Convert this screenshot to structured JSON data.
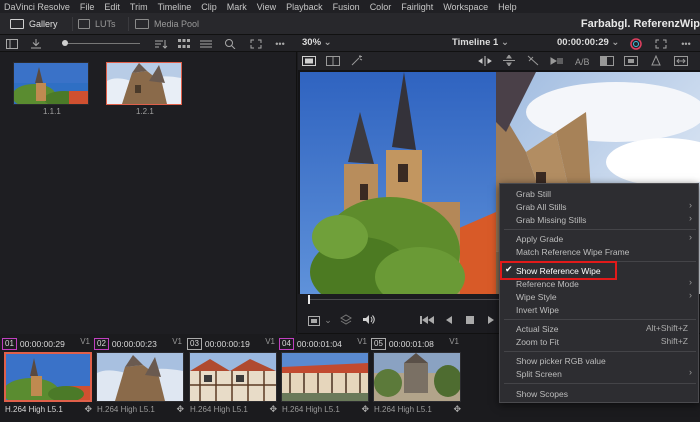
{
  "menubar": [
    "DaVinci Resolve",
    "File",
    "Edit",
    "Trim",
    "Timeline",
    "Clip",
    "Mark",
    "View",
    "Playback",
    "Fusion",
    "Color",
    "Fairlight",
    "Workspace",
    "Help"
  ],
  "tabs": {
    "gallery": "Gallery",
    "luts": "LUTs",
    "media_pool": "Media Pool"
  },
  "project_title": "Farbabgl. ReferenzWip",
  "toolbar": {
    "zoom": "30%",
    "timeline": "Timeline 1",
    "timecode": "00:00:00:29",
    "more": "•••"
  },
  "gallery": {
    "stills": [
      {
        "label": "1.1.1"
      },
      {
        "label": "1.2.1"
      }
    ]
  },
  "clips": [
    {
      "num": "01",
      "tc": "00:00:00:29",
      "track": "V1",
      "codec": "H.264 High L5.1",
      "color": "#c040c0"
    },
    {
      "num": "02",
      "tc": "00:00:00:23",
      "track": "V1",
      "codec": "H.264 High L5.1",
      "color": "#c040c0"
    },
    {
      "num": "03",
      "tc": "00:00:00:19",
      "track": "V1",
      "codec": "H.264 High L5.1",
      "color": "#aaaaaa"
    },
    {
      "num": "04",
      "tc": "00:00:01:04",
      "track": "V1",
      "codec": "H.264 High L5.1",
      "color": "#c040c0"
    },
    {
      "num": "05",
      "tc": "00:00:01:08",
      "track": "V1",
      "codec": "H.264 High L5.1",
      "color": "#aaaaaa"
    }
  ],
  "context_menu": {
    "grab_still": "Grab Still",
    "grab_all_stills": "Grab All Stills",
    "grab_missing_stills": "Grab Missing Stills",
    "apply_grade": "Apply Grade",
    "match_reference": "Match Reference Wipe Frame",
    "show_reference_wipe": "Show Reference Wipe",
    "reference_mode": "Reference Mode",
    "wipe_style": "Wipe Style",
    "invert_wipe": "Invert Wipe",
    "actual_size": "Actual Size",
    "actual_size_sc": "Alt+Shift+Z",
    "zoom_to_fit": "Zoom to Fit",
    "zoom_to_fit_sc": "Shift+Z",
    "show_picker_rgb": "Show picker RGB value",
    "split_screen": "Split Screen",
    "show_scopes": "Show Scopes"
  },
  "colors": {
    "accent": "#e0604a",
    "highlight": "#e21a1a"
  }
}
